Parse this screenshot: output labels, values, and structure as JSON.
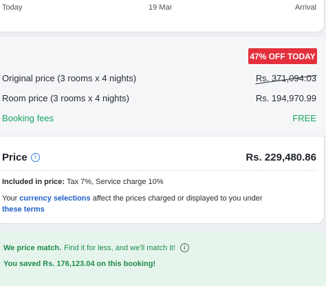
{
  "timeline": {
    "left_label": "Today",
    "middle_label": "19 Mar",
    "right_label": "Arrival"
  },
  "pricing": {
    "discount_badge": "47% OFF TODAY",
    "original_label": "Original price (3 rooms x 4 nights)",
    "original_value": "Rs. 371,094.03",
    "room_label": "Room price (3 rooms x 4 nights)",
    "room_value": "Rs. 194,970.99",
    "fees_label": "Booking fees",
    "fees_value": "FREE",
    "total_label": "Price",
    "total_value": "Rs. 229,480.86",
    "included_label": "Included in price:",
    "included_text": "Tax 7%, Service charge 10%",
    "currency_prefix": "Your",
    "currency_link": "currency selections",
    "currency_suffix": "affect the prices charged or displayed to you under",
    "terms_link": "these terms"
  },
  "price_match": {
    "title": "We price match.",
    "text": "Find it for less, and we'll match it!",
    "saved": "You saved Rs. 176,123.04 on this booking!"
  },
  "colors": {
    "badge_red": "#e4303d",
    "free_green": "#1aa260",
    "link_blue": "#2061c7",
    "match_bg": "#e6f5ec"
  }
}
